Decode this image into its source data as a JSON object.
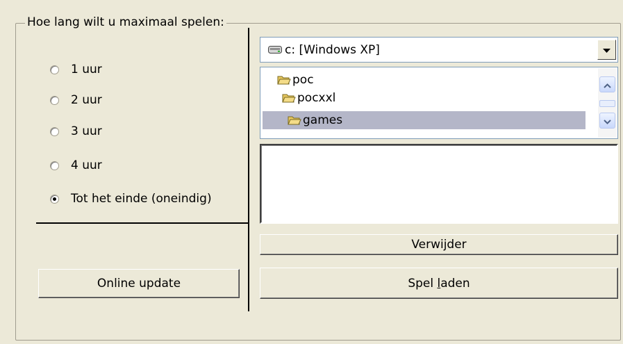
{
  "group": {
    "title": "Hoe lang wilt u maximaal spelen:"
  },
  "radios": [
    {
      "label": "1 uur",
      "checked": false
    },
    {
      "label": "2 uur",
      "checked": false
    },
    {
      "label": "3 uur",
      "checked": false
    },
    {
      "label": "4 uur",
      "checked": false
    },
    {
      "label": "Tot het einde (oneindig)",
      "checked": true
    }
  ],
  "drive": {
    "icon": "drive-icon",
    "label": "c: [Windows XP]"
  },
  "folders": [
    {
      "name": "poc",
      "icon": "folder-open-icon",
      "selected": false
    },
    {
      "name": "pocxxl",
      "icon": "folder-open-icon",
      "selected": false
    },
    {
      "name": "games",
      "icon": "folder-open-icon",
      "selected": true
    }
  ],
  "buttons": {
    "online_update": "Online update",
    "remove": "Verwijder",
    "load_pre": "Spel ",
    "load_accel": "l",
    "load_post": "aden"
  },
  "colors": {
    "background": "#ece9d8",
    "selection": "#b4b6c8",
    "field_border": "#7f9db9"
  }
}
